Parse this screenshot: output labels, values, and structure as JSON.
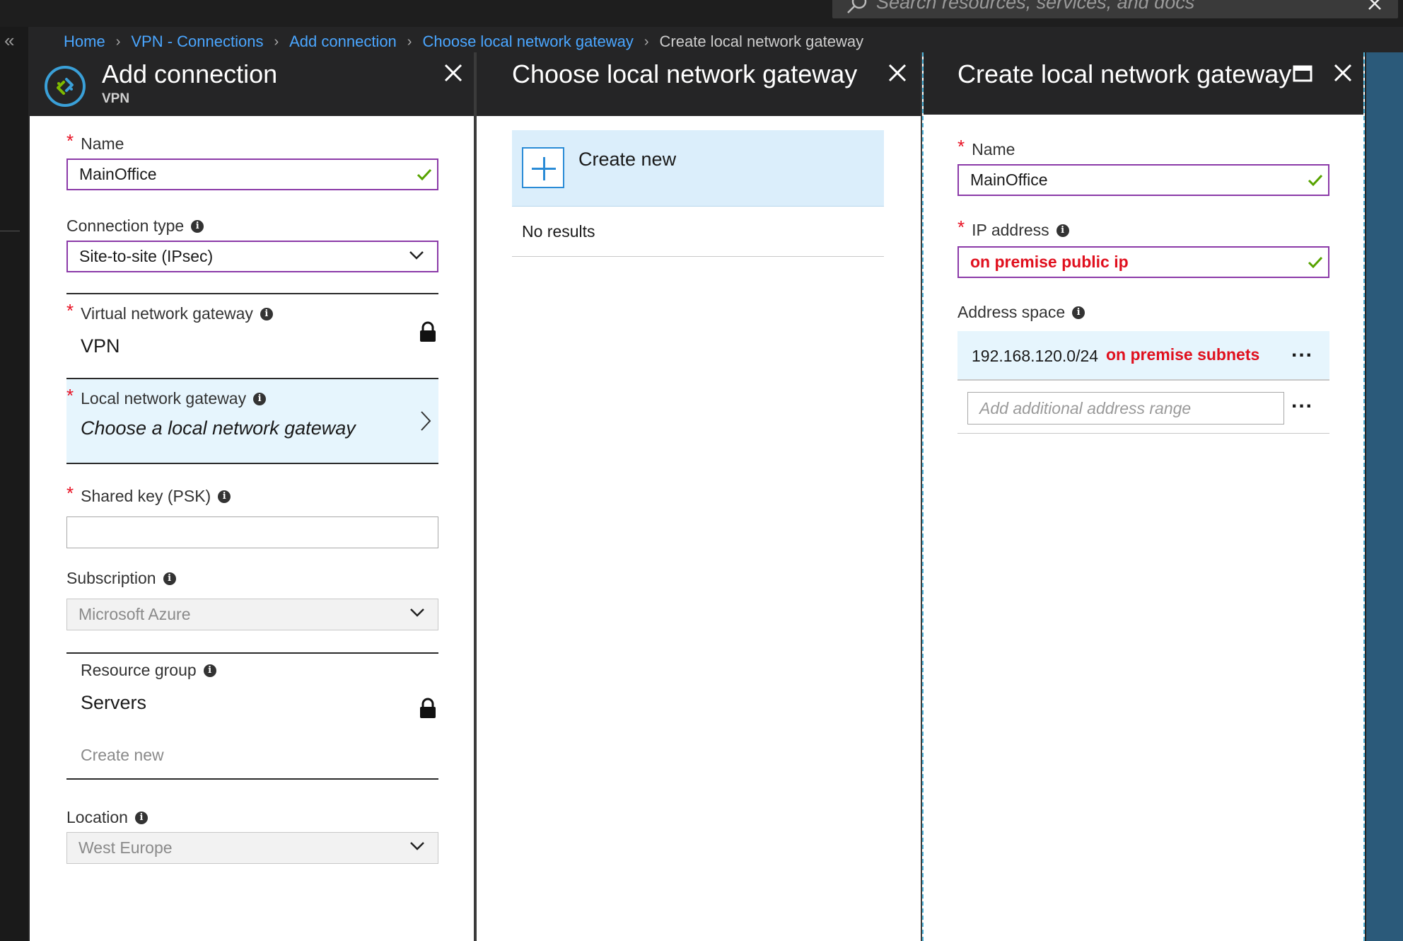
{
  "search": {
    "placeholder": "Search resources, services, and docs"
  },
  "breadcrumb": [
    "Home",
    "VPN - Connections",
    "Add connection",
    "Choose local network gateway",
    "Create local network gateway"
  ],
  "blade1": {
    "title": "Add connection",
    "subtitle": "VPN",
    "name_label": "Name",
    "name_value": "MainOffice",
    "connection_type_label": "Connection type",
    "connection_type_value": "Site-to-site (IPsec)",
    "vng_label": "Virtual network gateway",
    "vng_value": "VPN",
    "lng_label": "Local network gateway",
    "lng_value": "Choose a local network gateway",
    "psk_label": "Shared key (PSK)",
    "psk_value": "",
    "subscription_label": "Subscription",
    "subscription_value": "Microsoft Azure",
    "rg_label": "Resource group",
    "rg_value": "Servers",
    "rg_create": "Create new",
    "location_label": "Location",
    "location_value": "West Europe"
  },
  "blade2": {
    "title": "Choose local network gateway",
    "create_new": "Create new",
    "no_results": "No results"
  },
  "blade3": {
    "title": "Create local network gateway",
    "name_label": "Name",
    "name_value": "MainOffice",
    "ip_label": "IP address",
    "ip_value": "on premise public ip",
    "address_space_label": "Address space",
    "address_range": "192.168.120.0/24",
    "address_annotation": "on premise subnets",
    "add_range_placeholder": "Add additional address range",
    "more": "..."
  },
  "colors": {
    "accent_link": "#4aa6ff",
    "input_border": "#8b3aa8",
    "required": "#e81123",
    "selected_bg": "#e6f5fd",
    "check": "#57a300",
    "annotation": "#e0101e"
  }
}
